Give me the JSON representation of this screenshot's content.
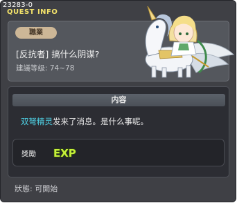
{
  "header": {
    "quest_id": "23283-0",
    "title": "QUEST INFO"
  },
  "quest": {
    "job_badge": "職業",
    "name": "[反抗者] 搞什么阴谋?",
    "recommended_level": "建議等级: 74~78"
  },
  "content": {
    "header": "内容",
    "highlight_name": "双弩精灵",
    "message": "发来了消息。是什么事呢。"
  },
  "reward": {
    "label": "獎勵",
    "exp_text": "EXP"
  },
  "status": {
    "text": "狀態:  可開始"
  },
  "colors": {
    "accent": "#f4e36a",
    "highlight": "#4fd4e8",
    "panel": "#54575d",
    "background": "#3f4045"
  }
}
